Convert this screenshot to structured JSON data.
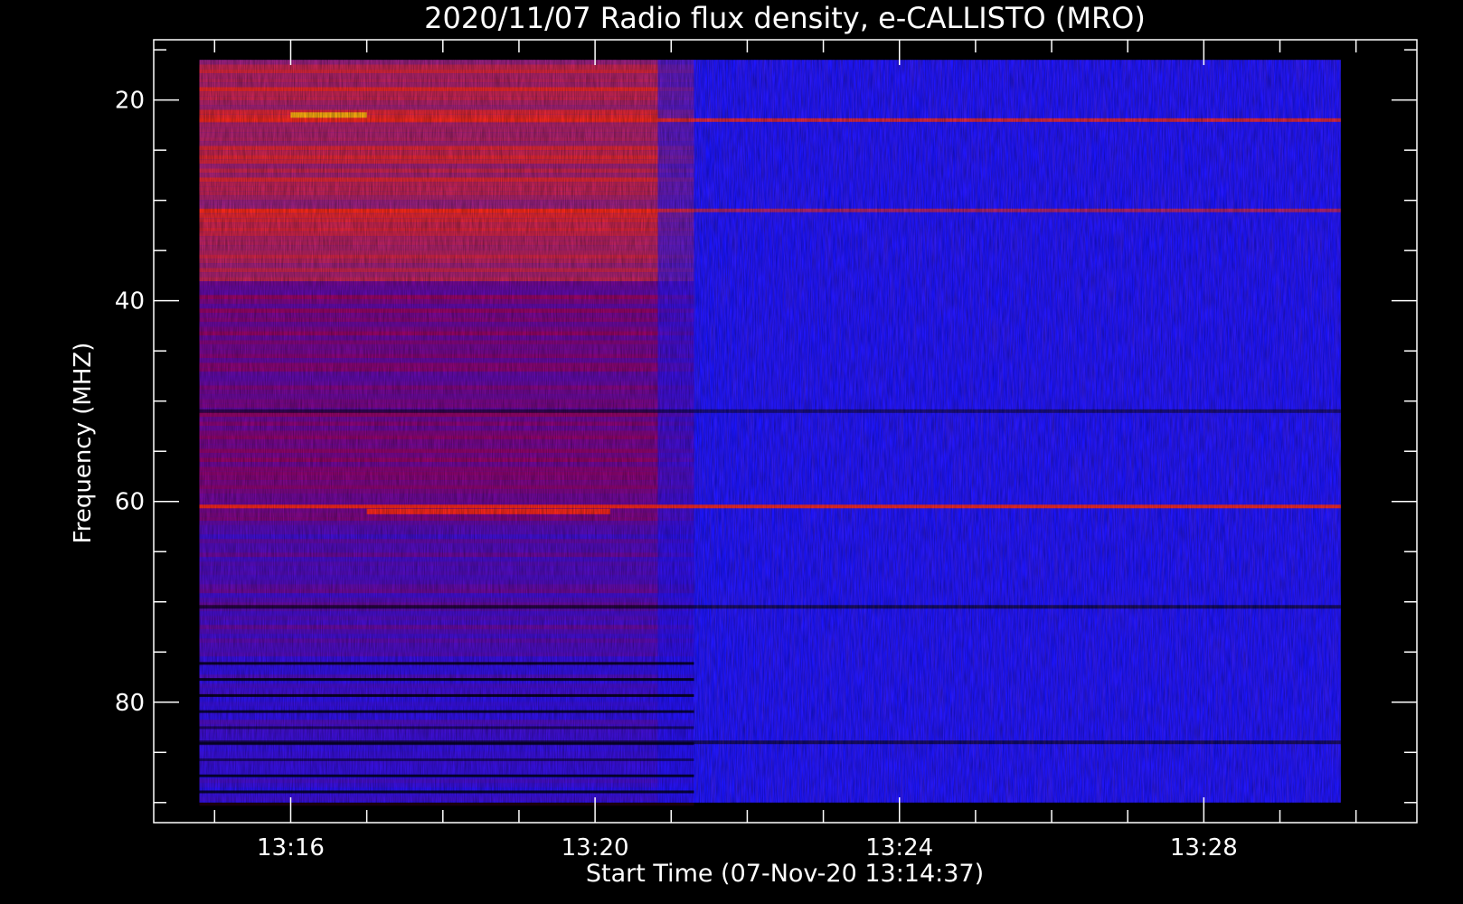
{
  "chart_data": {
    "type": "heatmap",
    "title": "2020/11/07  Radio flux density, e-CALLISTO (MRO)",
    "xlabel": "Start Time (07-Nov-20 13:14:37)",
    "ylabel": "Frequency (MHZ)",
    "x_ticks": [
      "13:16",
      "13:20",
      "13:24",
      "13:28"
    ],
    "x_tick_minutes": [
      16,
      20,
      24,
      28
    ],
    "y_ticks": [
      "20",
      "40",
      "60",
      "80"
    ],
    "y_tick_values": [
      20,
      40,
      60,
      80
    ],
    "xlim_minutes": [
      14.2,
      30.8
    ],
    "ylim_mhz": [
      14,
      92
    ],
    "data_extent": {
      "time_minutes": [
        14.8,
        29.8
      ],
      "freq_mhz": [
        16,
        90
      ]
    },
    "burst_end_minutes": 21.3,
    "colors": {
      "background": "#000000",
      "low": "#1a14ff",
      "mid": "#b00040",
      "high": "#ff2a10",
      "peak": "#ffe000"
    }
  }
}
